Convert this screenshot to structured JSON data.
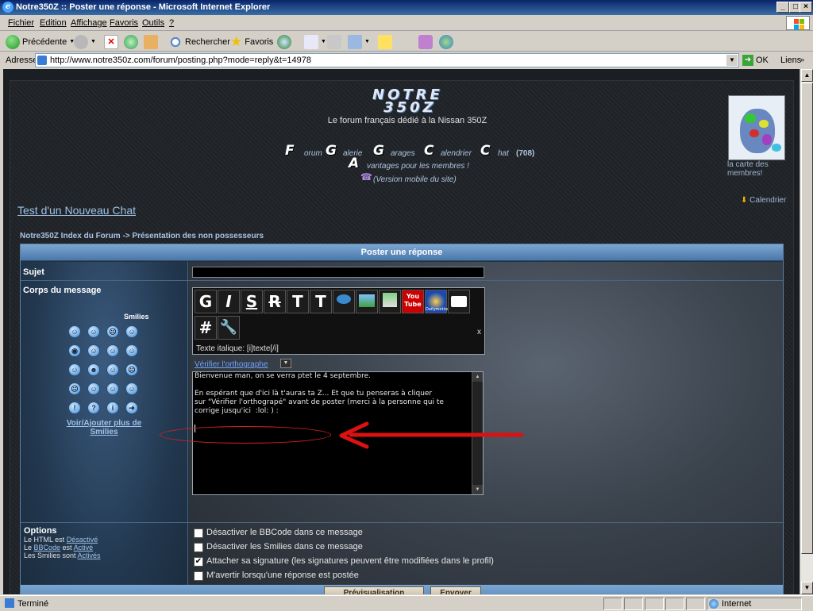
{
  "window": {
    "title": "Notre350Z :: Poster une réponse - Microsoft Internet Explorer",
    "controls": [
      "_",
      "□",
      "×"
    ]
  },
  "menu": [
    "Fichier",
    "Edition",
    "Affichage",
    "Favoris",
    "Outils",
    "?"
  ],
  "toolbar": {
    "back": "Précédente",
    "search": "Rechercher",
    "favorites": "Favoris"
  },
  "address": {
    "label": "Adresse",
    "url": "http://www.notre350z.com/forum/posting.php?mode=reply&t=14978",
    "go": "OK",
    "links": "Liens"
  },
  "header": {
    "logo_line1": "NOTRE",
    "logo_line2": "350Z",
    "tagline": "Le forum français dédié à la Nissan 350Z",
    "nav": [
      {
        "big": "F",
        "small": "orum"
      },
      {
        "big": "G",
        "small": "alerie"
      },
      {
        "big": "G",
        "small": "arages"
      },
      {
        "big": "C",
        "small": "alendrier"
      },
      {
        "big": "C",
        "small": "hat"
      }
    ],
    "chat_count": "(708)",
    "nav2_big": "A",
    "nav2_small": "vantages pour les membres !",
    "mobile": "(Version mobile du site)",
    "map_label": "la carte des membres!",
    "calendar": "Calendrier",
    "chat_link": "Test d'un Nouveau Chat",
    "breadcrumb": "Notre350Z Index du Forum -> Présentation des non possesseurs"
  },
  "form": {
    "heading": "Poster une réponse",
    "subject_label": "Sujet",
    "body_label": "Corps du message",
    "smilies_title": "Smilies",
    "smilies": [
      "☺",
      "☺",
      "☹",
      "☺",
      "◉",
      "☺",
      "☺",
      "☺",
      "☺",
      "☻",
      "☺",
      "☹",
      "☹",
      "☺",
      "☺",
      "☺",
      "!",
      "?",
      "i",
      "➜"
    ],
    "more_smilies": "Voir/Ajouter plus de Smilies",
    "bbcode_buttons": [
      "G",
      "I",
      "S",
      "R",
      "T",
      "T"
    ],
    "bbcode_special": [
      "#",
      "🔧"
    ],
    "youtube_label": "You Tube",
    "dailymotion_label": "Dailymotion",
    "bbcode_hint": "Texte italique: [i]texte[/i]",
    "bbcode_close": "x",
    "spell_link": "Vérifier l'orthographe",
    "message": "Bienvenue man, on se verra ptet le 4 septembre.\n\nEn espérant que d'ici là t'auras ta Z... Et que tu penseras à cliquer\nsur \"Vérifier l'orthograpé\" avant de poster (merci à la personne qui te\ncorrige jusqu'ici  :lol: ) :",
    "options_label": "Options",
    "html_status": [
      "Le HTML est ",
      "Désactivé"
    ],
    "bbcode_status": [
      "Le ",
      "BBCode",
      " est ",
      "Activé"
    ],
    "smilies_status": [
      "Les Smilies sont ",
      "Activés"
    ],
    "checkboxes": [
      {
        "label": "Désactiver le BBCode dans ce message",
        "checked": false
      },
      {
        "label": "Désactiver les Smilies dans ce message",
        "checked": false
      },
      {
        "label": "Attacher sa signature (les signatures peuvent être modifiées dans le profil)",
        "checked": true
      },
      {
        "label": "M'avertir lorsqu'une réponse est postée",
        "checked": false
      }
    ],
    "preview_btn": "Prévisualisation",
    "submit_btn": "Envoyer"
  },
  "status": {
    "text": "Terminé",
    "zone": "Internet"
  },
  "colors": {
    "annotation": "#dd1111",
    "link": "#9fc1e6",
    "header_bar": "#5a88b8"
  }
}
